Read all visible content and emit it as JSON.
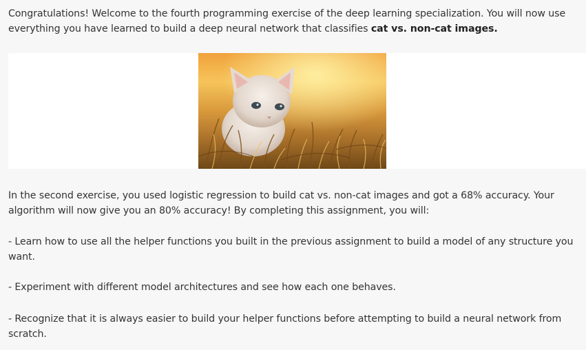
{
  "intro": {
    "text_before_bold": "Congratulations! Welcome to the fourth programming exercise of the deep learning specialization. You will now use everything you have learned to build a deep neural network that classifies ",
    "bold_text": "cat vs. non-cat images."
  },
  "image": {
    "subject": "kitten-in-grass-photo",
    "colors": {
      "sky_top": "#f3a53a",
      "sky_mid": "#f7c85a",
      "grass_dark": "#8a5a1c",
      "grass_light": "#d9a24a",
      "fur": "#ece4dc"
    }
  },
  "paragraph2": "In the second exercise, you used logistic regression to build cat vs. non-cat images and got a 68% accuracy. Your algorithm will now give you an 80% accuracy! By completing this assignment, you will:",
  "bullets": [
    "- Learn how to use all the helper functions you built in the previous assignment to build a model of any structure you want.",
    "- Experiment with different model architectures and see how each one behaves.",
    "- Recognize that it is always easier to build your helper functions before attempting to build a neural network from scratch."
  ]
}
